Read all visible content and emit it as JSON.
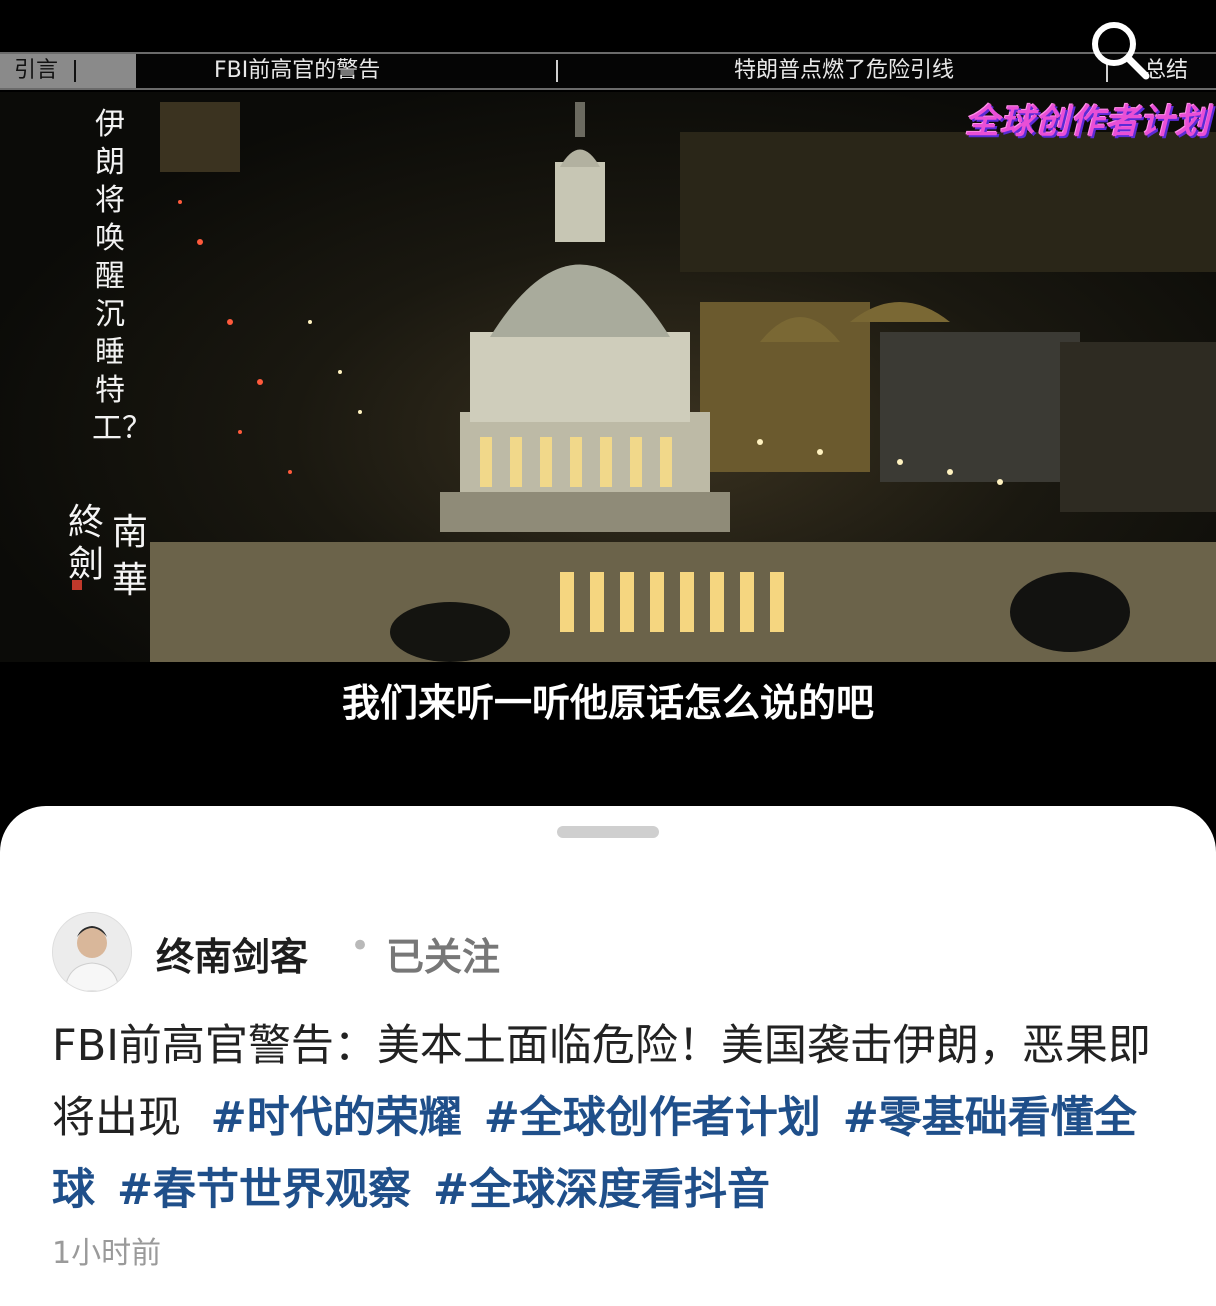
{
  "video": {
    "chapters": [
      {
        "label": "引言",
        "active": true
      },
      {
        "label": "FBI前高官的警告",
        "active": false
      },
      {
        "label": "特朗普点燃了危险引线",
        "active": false
      },
      {
        "label": "总结",
        "active": false
      }
    ],
    "search_icon": "search-icon",
    "promo_badge": "全球创作者计划",
    "vertical_caption": "伊朗将唤醒沉睡特工？",
    "brand_logo_text": "終南劍華",
    "subtitle": "我们来听一听他原话怎么说的吧"
  },
  "post": {
    "author": {
      "name": "终南剑客",
      "follow_status": "已关注"
    },
    "text": "FBI前高官警告：美本土面临危险！美国袭击伊朗，恶果即将出现",
    "hashtags": [
      "#时代的荣耀",
      "#全球创作者计划",
      "#零基础看懂全球",
      "#春节世界观察",
      "#全球深度看抖音"
    ],
    "timestamp": "1小时前"
  }
}
